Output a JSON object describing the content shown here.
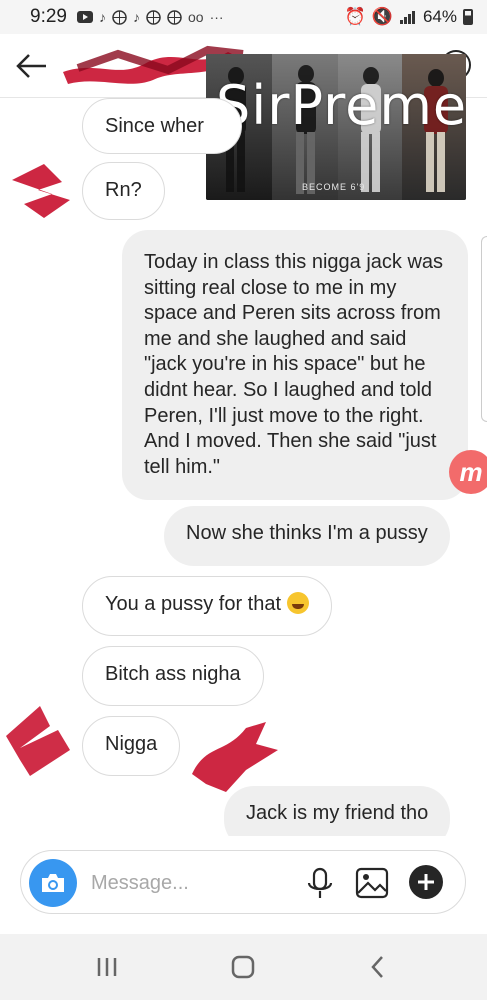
{
  "status_bar": {
    "time": "9:29",
    "battery": "64%",
    "battery_level": 0.64
  },
  "header": {
    "back_icon": "arrow-left-icon",
    "info_icon": "info-icon"
  },
  "overlay": {
    "brand": "SirPreme",
    "tagline": "BECOME 6'9"
  },
  "messages": [
    {
      "side": "in",
      "text": "Since wher"
    },
    {
      "side": "in",
      "text": "Rn?"
    },
    {
      "side": "out",
      "text": "Today in class this nigga jack was sitting real close to me in my space and Peren sits across from me and she laughed and said \"jack you're in his space\" but he didnt hear. So I laughed and told Peren, I'll just move to the right. And I moved. Then she said \"just tell him.\""
    },
    {
      "side": "out",
      "text": "Now she thinks I'm a pussy"
    },
    {
      "side": "in",
      "text": "You a pussy for that",
      "emoji": "winking-tongue-emoji"
    },
    {
      "side": "in",
      "text": "Bitch ass nigha"
    },
    {
      "side": "in",
      "text": "Nigga"
    },
    {
      "side": "out",
      "text": "Jack is my friend tho"
    }
  ],
  "badge": {
    "letter": "m",
    "color": "#f26b6b"
  },
  "composer": {
    "placeholder": "Message...",
    "value": "",
    "camera_color": "#3897f0"
  },
  "navbar": {
    "recent_icon": "recent-apps-icon",
    "home_icon": "home-icon",
    "back_icon": "back-chevron-icon"
  },
  "colors": {
    "scribble": "#c8102e",
    "outgoing_bubble": "#efefef",
    "incoming_border": "#dbdbdb"
  }
}
